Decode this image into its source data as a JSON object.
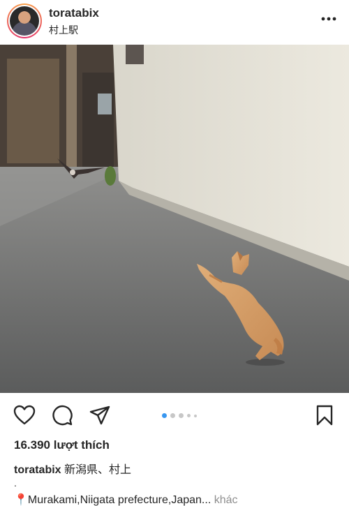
{
  "post": {
    "username": "toratabix",
    "location": "村上駅",
    "likes": "16.390 lượt thích",
    "caption_user": "toratabix",
    "caption_text": " 新潟県、村上",
    "caption_dot": ".",
    "pin_text": "📍Murakami,Niigata prefecture,Japan...",
    "more_label": " khác"
  },
  "carousel": {
    "total": 5,
    "active": 1
  },
  "icons": {
    "more": "more-horizontal-icon",
    "like": "heart-icon",
    "comment": "comment-icon",
    "share": "send-icon",
    "save": "bookmark-icon"
  },
  "colors": {
    "accent": "#3897f0",
    "text": "#262626",
    "muted": "#8e8e8e"
  }
}
